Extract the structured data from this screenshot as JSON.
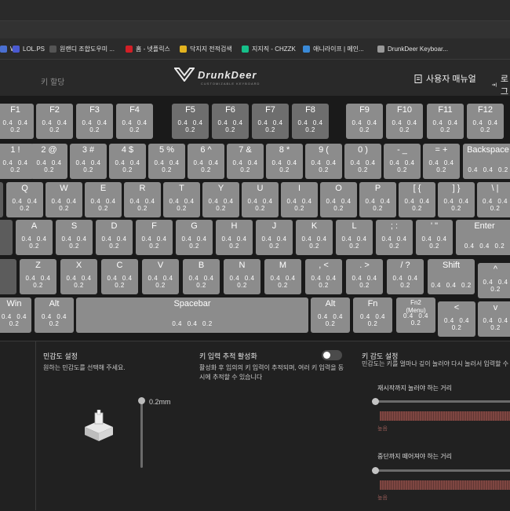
{
  "bookmarks": [
    {
      "label": "W",
      "icon": "w-icon",
      "color": "#4a6fd1"
    },
    {
      "label": "LOL.PS",
      "icon": "lolps-icon",
      "color": "#4a5ad1"
    },
    {
      "label": "원랜디 조합도우미 ...",
      "icon": "game-icon",
      "color": "#555555"
    },
    {
      "label": "홈 - 넷플릭스",
      "icon": "netflix-icon",
      "color": "#d21f26"
    },
    {
      "label": "닥지지 전적검색",
      "icon": "dakgg-icon",
      "color": "#e3b31f"
    },
    {
      "label": "지지직 - CHZZK",
      "icon": "chzzk-icon",
      "color": "#16c08a"
    },
    {
      "label": "애니라이프 | 메인...",
      "icon": "anilife-icon",
      "color": "#3a8ad8"
    },
    {
      "label": "DrunkDeer Keyboar...",
      "icon": "page-icon",
      "color": "#999999"
    }
  ],
  "header": {
    "left_text": "키 할당",
    "brand": "DrunkDeer",
    "brand_sub": "CUSTOMIZABLE KEYBOARD",
    "manual": "사용자 매뉴얼",
    "login": "로그"
  },
  "key_values": "0.4 0.4 0.2",
  "keys": [
    {
      "label": "F1"
    },
    {
      "label": "F2"
    },
    {
      "label": "F3"
    },
    {
      "label": "F4"
    },
    {
      "label": "F5",
      "dark": true
    },
    {
      "label": "F6",
      "dark": true
    },
    {
      "label": "F7",
      "dark": true
    },
    {
      "label": "F8",
      "dark": true
    },
    {
      "label": "F9"
    },
    {
      "label": "F10"
    },
    {
      "label": "F11"
    },
    {
      "label": "F12"
    },
    {
      "label": "1 !"
    },
    {
      "label": "2 @"
    },
    {
      "label": "3 #"
    },
    {
      "label": "4 $"
    },
    {
      "label": "5 %"
    },
    {
      "label": "6 ^"
    },
    {
      "label": "7 &"
    },
    {
      "label": "8 *"
    },
    {
      "label": "9 ("
    },
    {
      "label": "0 )"
    },
    {
      "label": "- _"
    },
    {
      "label": "= +"
    },
    {
      "label": "Backspace"
    },
    {
      "label": "Q"
    },
    {
      "label": "W"
    },
    {
      "label": "E"
    },
    {
      "label": "R"
    },
    {
      "label": "T"
    },
    {
      "label": "Y"
    },
    {
      "label": "U"
    },
    {
      "label": "I"
    },
    {
      "label": "O"
    },
    {
      "label": "P"
    },
    {
      "label": "[ {"
    },
    {
      "label": "] }"
    },
    {
      "label": "\\ |"
    },
    {
      "label": "A"
    },
    {
      "label": "S"
    },
    {
      "label": "D"
    },
    {
      "label": "F"
    },
    {
      "label": "G"
    },
    {
      "label": "H"
    },
    {
      "label": "J"
    },
    {
      "label": "K"
    },
    {
      "label": "L"
    },
    {
      "label": "; :"
    },
    {
      "label": "' \""
    },
    {
      "label": "Enter"
    },
    {
      "label": "Z"
    },
    {
      "label": "X"
    },
    {
      "label": "C"
    },
    {
      "label": "V"
    },
    {
      "label": "B"
    },
    {
      "label": "N"
    },
    {
      "label": "M"
    },
    {
      "label": ", <"
    },
    {
      "label": ". >"
    },
    {
      "label": "/ ?"
    },
    {
      "label": "Shift"
    },
    {
      "label": "^"
    },
    {
      "label": "Win"
    },
    {
      "label": "Alt"
    },
    {
      "label": "Spacebar"
    },
    {
      "label": "Alt"
    },
    {
      "label": "Fn"
    },
    {
      "label": "Fn2\n(Menu)"
    },
    {
      "label": "<"
    },
    {
      "label": "v"
    }
  ],
  "blank_keys": 5,
  "panel_left": {
    "title": "민감도 설정",
    "desc": "원하는 민감도를 선택해 주세요.",
    "slider_value": "0.2mm"
  },
  "panel_middle": {
    "title": "키 입력 추적 활성화",
    "desc": "활성화 후 임의의 키 입력이 추적되며, 여러 키 입력을 동시에 추적할 수 있습니다",
    "toggle_on": false
  },
  "panel_right": {
    "title": "키 감도 설정",
    "desc": "민감도는 키를 얼마나 깊이 눌러야 다시 눌러서 입력할 수 있",
    "slider1_label": "재시작까지 눌러야 하는 거리",
    "slider1_low": "높음",
    "slider2_label": "중단까지 떼어져야 하는 거리",
    "slider2_low": "높음"
  }
}
